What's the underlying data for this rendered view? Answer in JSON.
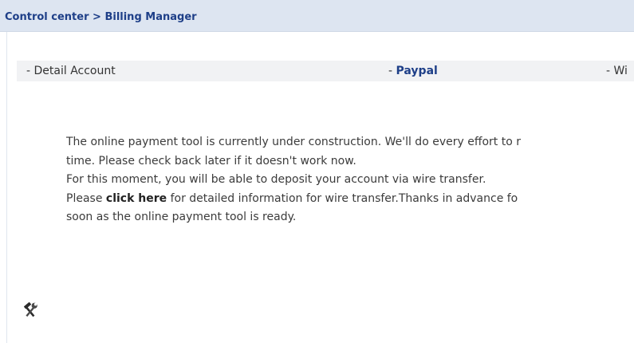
{
  "breadcrumb": {
    "root": "Control center",
    "separator": " > ",
    "current": "Billing Manager"
  },
  "tabs": [
    {
      "prefix": "- ",
      "label": "Detail Account",
      "active": false
    },
    {
      "prefix": "- ",
      "label": "Paypal",
      "active": true
    },
    {
      "prefix": "- ",
      "label": "Wi",
      "active": false
    }
  ],
  "message": {
    "line1": "The online payment tool is currently under construction. We'll do every effort to r",
    "line2": "time. Please check back later if it doesn't work now.",
    "line3": "For this moment, you will be able to deposit your account via wire transfer.",
    "line4_before": "Please ",
    "line4_link": "click here",
    "line4_after": " for detailed information for wire transfer.Thanks in advance fo",
    "line5": "soon as the online payment tool is ready."
  },
  "icons": {
    "tools": "hammer-wrench-icon"
  },
  "colors": {
    "header_bg": "#dde5f1",
    "link_blue": "#1e3f88",
    "tab_bg": "#f1f2f4",
    "text": "#3b3b3b"
  }
}
